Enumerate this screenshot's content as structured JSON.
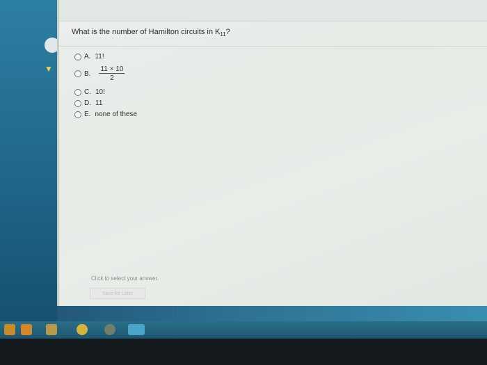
{
  "question": {
    "text": "What is the number of Hamilton circuits in K",
    "subscript": "11",
    "suffix": "?"
  },
  "options": [
    {
      "letter": "A.",
      "text": "11!"
    },
    {
      "letter": "B.",
      "numerator": "11 × 10",
      "denominator": "2"
    },
    {
      "letter": "C.",
      "text": "10!"
    },
    {
      "letter": "D.",
      "text": "11"
    },
    {
      "letter": "E.",
      "text": "none of these"
    }
  ],
  "footer": {
    "hint": "Click to select your answer.",
    "save_label": "Save for Later"
  },
  "colors": {
    "taskbar": "#1d5670",
    "panel_bg": "#e9ede8",
    "text": "#2d3238"
  }
}
